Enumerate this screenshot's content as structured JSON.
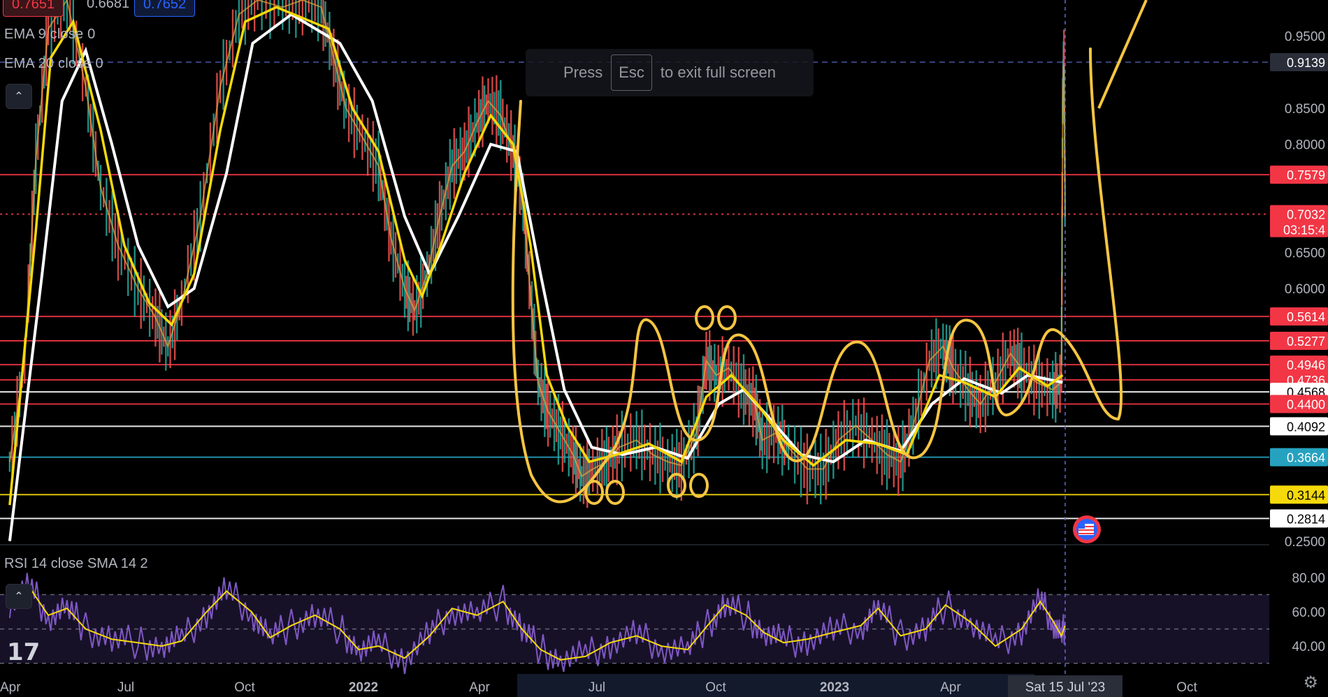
{
  "chart_data": {
    "type": "line",
    "title": "",
    "indicators": {
      "ema9": "EMA 9 close 0",
      "ema20": "EMA 20 close 0",
      "rsi": "RSI 14 close SMA 14 2"
    },
    "price_axis": {
      "ylim": [
        0.245,
        1.0
      ],
      "ticks": [
        "0.9500",
        "0.8500",
        "0.8000",
        "0.6500",
        "0.6000",
        "0.2500"
      ]
    },
    "rsi_axis": {
      "ylim": [
        25,
        95
      ],
      "ticks": [
        "80.00",
        "60.00",
        "40.00"
      ]
    },
    "x_labels": [
      "Apr",
      "Jul",
      "Oct",
      "2022",
      "Apr",
      "Jul",
      "Oct",
      "2023",
      "Apr",
      "Oct"
    ],
    "crosshair_date": "Sat 15 Jul '23",
    "levels": [
      {
        "value": 0.9139,
        "label": "0.9139",
        "color": "#2a2e39",
        "style": "dashed",
        "text_color": "#ffffff"
      },
      {
        "value": 0.7579,
        "label": "0.7579",
        "color": "#f23645",
        "style": "solid",
        "text_color": "#ffffff"
      },
      {
        "value": 0.7032,
        "label": "0.7032",
        "sub": "03:15:4",
        "color": "#f23645",
        "style": "dotted",
        "text_color": "#ffffff"
      },
      {
        "value": 0.5614,
        "label": "0.5614",
        "color": "#f23645",
        "style": "solid",
        "text_color": "#ffffff"
      },
      {
        "value": 0.5277,
        "label": "0.5277",
        "color": "#f23645",
        "style": "solid",
        "text_color": "#ffffff"
      },
      {
        "value": 0.4946,
        "label": "0.4946",
        "color": "#f23645",
        "style": "solid",
        "text_color": "#ffffff"
      },
      {
        "value": 0.4736,
        "label": "0.4736",
        "color": "#f23645",
        "style": "solid",
        "text_color": "#ffffff"
      },
      {
        "value": 0.4568,
        "label": "0.4568",
        "color": "#ffffff",
        "style": "solid",
        "text_color": "#000000"
      },
      {
        "value": 0.44,
        "label": "0.4400",
        "color": "#f23645",
        "style": "solid",
        "text_color": "#ffffff"
      },
      {
        "value": 0.4092,
        "label": "0.4092",
        "color": "#ffffff",
        "style": "solid",
        "text_color": "#000000"
      },
      {
        "value": 0.3664,
        "label": "0.3664",
        "color": "#26a2c0",
        "style": "solid",
        "text_color": "#ffffff"
      },
      {
        "value": 0.3144,
        "label": "0.3144",
        "color": "#f5d90a",
        "style": "solid",
        "text_color": "#000000"
      },
      {
        "value": 0.2814,
        "label": "0.2814",
        "color": "#ffffff",
        "style": "solid",
        "text_color": "#000000"
      }
    ],
    "price_series": {
      "name": "",
      "points": [
        [
          "2021-03-20",
          0.36
        ],
        [
          "2021-04-01",
          0.5
        ],
        [
          "2021-04-10",
          0.78
        ],
        [
          "2021-04-20",
          0.96
        ],
        [
          "2021-05-05",
          1.0
        ],
        [
          "2021-05-20",
          0.88
        ],
        [
          "2021-06-01",
          0.74
        ],
        [
          "2021-06-15",
          0.66
        ],
        [
          "2021-07-01",
          0.6
        ],
        [
          "2021-07-15",
          0.56
        ],
        [
          "2021-07-25",
          0.52
        ],
        [
          "2021-08-05",
          0.58
        ],
        [
          "2021-08-20",
          0.7
        ],
        [
          "2021-09-05",
          0.88
        ],
        [
          "2021-09-20",
          0.98
        ],
        [
          "2021-10-05",
          1.0
        ],
        [
          "2021-10-25",
          0.99
        ],
        [
          "2021-11-10",
          1.0
        ],
        [
          "2021-11-25",
          0.99
        ],
        [
          "2021-12-05",
          0.92
        ],
        [
          "2021-12-15",
          0.85
        ],
        [
          "2021-12-28",
          0.81
        ],
        [
          "2022-01-10",
          0.77
        ],
        [
          "2022-01-20",
          0.67
        ],
        [
          "2022-01-31",
          0.6
        ],
        [
          "2022-02-08",
          0.57
        ],
        [
          "2022-02-18",
          0.62
        ],
        [
          "2022-02-28",
          0.7
        ],
        [
          "2022-03-10",
          0.77
        ],
        [
          "2022-03-20",
          0.79
        ],
        [
          "2022-03-30",
          0.83
        ],
        [
          "2022-04-08",
          0.86
        ],
        [
          "2022-04-18",
          0.84
        ],
        [
          "2022-04-28",
          0.79
        ],
        [
          "2022-05-06",
          0.72
        ],
        [
          "2022-05-12",
          0.59
        ],
        [
          "2022-05-18",
          0.47
        ],
        [
          "2022-05-26",
          0.43
        ],
        [
          "2022-06-05",
          0.4
        ],
        [
          "2022-06-15",
          0.37
        ],
        [
          "2022-06-22",
          0.34
        ],
        [
          "2022-07-01",
          0.35
        ],
        [
          "2022-07-12",
          0.36
        ],
        [
          "2022-07-22",
          0.38
        ],
        [
          "2022-08-05",
          0.39
        ],
        [
          "2022-08-18",
          0.37
        ],
        [
          "2022-08-30",
          0.36
        ],
        [
          "2022-09-10",
          0.355
        ],
        [
          "2022-09-22",
          0.4
        ],
        [
          "2022-09-30",
          0.5
        ],
        [
          "2022-10-08",
          0.48
        ],
        [
          "2022-10-18",
          0.49
        ],
        [
          "2022-10-30",
          0.46
        ],
        [
          "2022-11-08",
          0.44
        ],
        [
          "2022-11-14",
          0.39
        ],
        [
          "2022-11-25",
          0.4
        ],
        [
          "2022-12-05",
          0.38
        ],
        [
          "2022-12-20",
          0.35
        ],
        [
          "2023-01-02",
          0.35
        ],
        [
          "2023-01-14",
          0.39
        ],
        [
          "2023-01-28",
          0.41
        ],
        [
          "2023-02-10",
          0.39
        ],
        [
          "2023-02-22",
          0.37
        ],
        [
          "2023-03-05",
          0.36
        ],
        [
          "2023-03-15",
          0.41
        ],
        [
          "2023-03-28",
          0.5
        ],
        [
          "2023-04-08",
          0.52
        ],
        [
          "2023-04-16",
          0.49
        ],
        [
          "2023-04-28",
          0.46
        ],
        [
          "2023-05-08",
          0.44
        ],
        [
          "2023-05-20",
          0.47
        ],
        [
          "2023-06-01",
          0.51
        ],
        [
          "2023-06-10",
          0.49
        ],
        [
          "2023-06-22",
          0.47
        ],
        [
          "2023-07-05",
          0.46
        ],
        [
          "2023-07-12",
          0.47
        ],
        [
          "2023-07-13",
          0.86
        ],
        [
          "2023-07-14",
          0.91
        ],
        [
          "2023-07-15",
          0.7
        ]
      ]
    },
    "ema_fast": {
      "name": "EMA 9",
      "points": [
        [
          "2021-03-20",
          0.3
        ],
        [
          "2021-04-10",
          0.68
        ],
        [
          "2021-04-22",
          0.92
        ],
        [
          "2021-05-10",
          0.97
        ],
        [
          "2021-06-01",
          0.82
        ],
        [
          "2021-06-20",
          0.66
        ],
        [
          "2021-07-10",
          0.58
        ],
        [
          "2021-07-28",
          0.55
        ],
        [
          "2021-08-15",
          0.62
        ],
        [
          "2021-09-05",
          0.82
        ],
        [
          "2021-09-25",
          0.97
        ],
        [
          "2021-10-20",
          0.99
        ],
        [
          "2021-12-01",
          0.96
        ],
        [
          "2021-12-20",
          0.85
        ],
        [
          "2022-01-10",
          0.79
        ],
        [
          "2022-01-31",
          0.64
        ],
        [
          "2022-02-14",
          0.59
        ],
        [
          "2022-03-01",
          0.66
        ],
        [
          "2022-03-20",
          0.76
        ],
        [
          "2022-04-10",
          0.84
        ],
        [
          "2022-04-28",
          0.8
        ],
        [
          "2022-05-12",
          0.66
        ],
        [
          "2022-05-25",
          0.48
        ],
        [
          "2022-06-10",
          0.41
        ],
        [
          "2022-06-28",
          0.36
        ],
        [
          "2022-07-20",
          0.37
        ],
        [
          "2022-08-15",
          0.385
        ],
        [
          "2022-09-10",
          0.36
        ],
        [
          "2022-09-30",
          0.45
        ],
        [
          "2022-10-20",
          0.48
        ],
        [
          "2022-11-10",
          0.44
        ],
        [
          "2022-12-01",
          0.39
        ],
        [
          "2022-12-25",
          0.355
        ],
        [
          "2023-01-20",
          0.39
        ],
        [
          "2023-02-15",
          0.385
        ],
        [
          "2023-03-10",
          0.37
        ],
        [
          "2023-04-05",
          0.48
        ],
        [
          "2023-04-25",
          0.47
        ],
        [
          "2023-05-20",
          0.45
        ],
        [
          "2023-06-08",
          0.49
        ],
        [
          "2023-07-01",
          0.465
        ],
        [
          "2023-07-13",
          0.48
        ]
      ]
    },
    "ema_slow": {
      "name": "EMA 20",
      "points": [
        [
          "2021-03-20",
          0.25
        ],
        [
          "2021-04-15",
          0.62
        ],
        [
          "2021-05-01",
          0.86
        ],
        [
          "2021-05-20",
          0.93
        ],
        [
          "2021-06-10",
          0.8
        ],
        [
          "2021-07-01",
          0.66
        ],
        [
          "2021-07-25",
          0.575
        ],
        [
          "2021-08-15",
          0.6
        ],
        [
          "2021-09-10",
          0.76
        ],
        [
          "2021-10-01",
          0.94
        ],
        [
          "2021-11-01",
          0.98
        ],
        [
          "2021-12-10",
          0.94
        ],
        [
          "2022-01-05",
          0.86
        ],
        [
          "2022-01-31",
          0.7
        ],
        [
          "2022-02-20",
          0.62
        ],
        [
          "2022-03-15",
          0.7
        ],
        [
          "2022-04-10",
          0.8
        ],
        [
          "2022-05-01",
          0.79
        ],
        [
          "2022-05-20",
          0.62
        ],
        [
          "2022-06-08",
          0.46
        ],
        [
          "2022-06-30",
          0.38
        ],
        [
          "2022-07-25",
          0.37
        ],
        [
          "2022-08-20",
          0.38
        ],
        [
          "2022-09-15",
          0.365
        ],
        [
          "2022-10-10",
          0.44
        ],
        [
          "2022-10-30",
          0.46
        ],
        [
          "2022-11-20",
          0.42
        ],
        [
          "2022-12-15",
          0.37
        ],
        [
          "2023-01-10",
          0.36
        ],
        [
          "2023-02-05",
          0.39
        ],
        [
          "2023-03-05",
          0.375
        ],
        [
          "2023-03-30",
          0.44
        ],
        [
          "2023-04-25",
          0.475
        ],
        [
          "2023-05-25",
          0.455
        ],
        [
          "2023-06-15",
          0.48
        ],
        [
          "2023-07-13",
          0.47
        ]
      ]
    },
    "rsi_series": {
      "name": "RSI",
      "points": [
        [
          "2021-03-20",
          66
        ],
        [
          "2021-04-05",
          74
        ],
        [
          "2021-04-20",
          58
        ],
        [
          "2021-05-05",
          62
        ],
        [
          "2021-05-20",
          50
        ],
        [
          "2021-06-10",
          44
        ],
        [
          "2021-07-01",
          42
        ],
        [
          "2021-07-20",
          40
        ],
        [
          "2021-08-05",
          43
        ],
        [
          "2021-08-25",
          60
        ],
        [
          "2021-09-10",
          72
        ],
        [
          "2021-09-30",
          60
        ],
        [
          "2021-10-15",
          45
        ],
        [
          "2021-11-01",
          52
        ],
        [
          "2021-11-20",
          58
        ],
        [
          "2021-12-10",
          50
        ],
        [
          "2021-12-25",
          38
        ],
        [
          "2022-01-10",
          40
        ],
        [
          "2022-01-31",
          33
        ],
        [
          "2022-02-20",
          46
        ],
        [
          "2022-03-10",
          62
        ],
        [
          "2022-03-30",
          58
        ],
        [
          "2022-04-20",
          66
        ],
        [
          "2022-05-05",
          50
        ],
        [
          "2022-05-20",
          38
        ],
        [
          "2022-06-05",
          32
        ],
        [
          "2022-06-25",
          34
        ],
        [
          "2022-07-15",
          42
        ],
        [
          "2022-08-05",
          46
        ],
        [
          "2022-08-25",
          40
        ],
        [
          "2022-09-15",
          38
        ],
        [
          "2022-10-01",
          52
        ],
        [
          "2022-10-15",
          64
        ],
        [
          "2022-11-01",
          58
        ],
        [
          "2022-11-15",
          48
        ],
        [
          "2022-12-01",
          42
        ],
        [
          "2022-12-20",
          44
        ],
        [
          "2023-01-10",
          48
        ],
        [
          "2023-02-01",
          52
        ],
        [
          "2023-02-15",
          62
        ],
        [
          "2023-03-05",
          46
        ],
        [
          "2023-03-25",
          50
        ],
        [
          "2023-04-10",
          64
        ],
        [
          "2023-04-30",
          54
        ],
        [
          "2023-05-20",
          40
        ],
        [
          "2023-06-10",
          50
        ],
        [
          "2023-06-25",
          66
        ],
        [
          "2023-07-05",
          55
        ],
        [
          "2023-07-12",
          46
        ],
        [
          "2023-07-15",
          52
        ]
      ]
    },
    "rsi_band": [
      30,
      70
    ]
  },
  "ui": {
    "collapse_glyph": "⌃",
    "toast": {
      "press": "Press",
      "key": "Esc",
      "rest": "to exit full screen"
    },
    "logo": "17",
    "settings_icon": "gear-icon",
    "top_badges": [
      "0.7651",
      "0.6681",
      "0.7652"
    ]
  }
}
